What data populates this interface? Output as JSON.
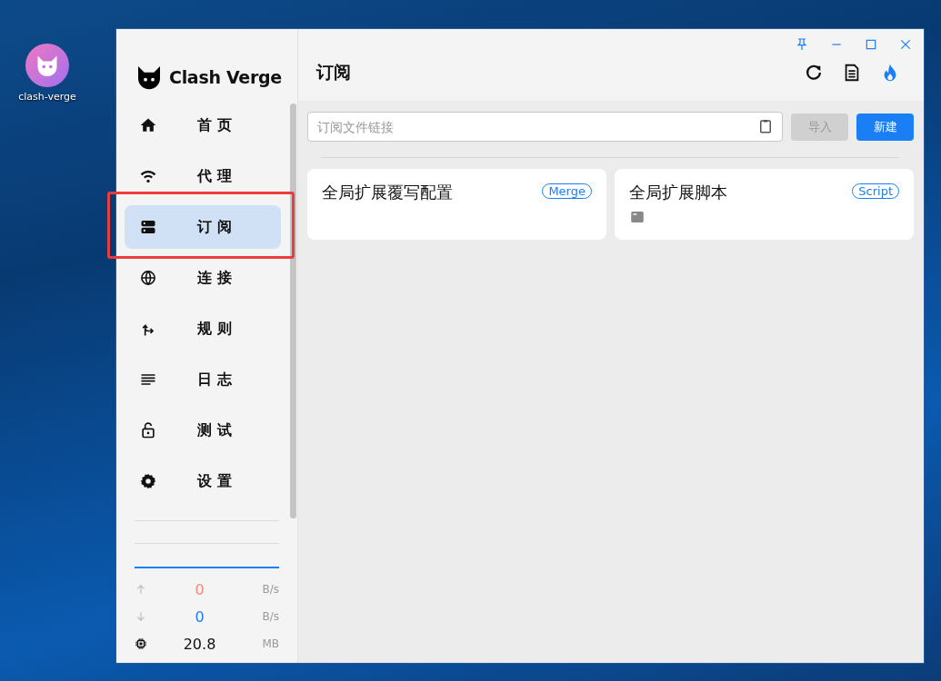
{
  "desktop": {
    "icon_label": "clash-verge"
  },
  "sidebar": {
    "logo_text": "Clash Verge",
    "items": [
      {
        "label": "首 页",
        "selected": false,
        "highlighted": false
      },
      {
        "label": "代 理",
        "selected": false,
        "highlighted": false
      },
      {
        "label": "订 阅",
        "selected": true,
        "highlighted": true
      },
      {
        "label": "连 接",
        "selected": false,
        "highlighted": false
      },
      {
        "label": "规 则",
        "selected": false,
        "highlighted": false
      },
      {
        "label": "日 志",
        "selected": false,
        "highlighted": false
      },
      {
        "label": "测 试",
        "selected": false,
        "highlighted": false
      },
      {
        "label": "设 置",
        "selected": false,
        "highlighted": false
      }
    ],
    "stats": [
      {
        "kind": "up",
        "value": "0",
        "unit": "B/s",
        "color": "#f28b7c"
      },
      {
        "kind": "down",
        "value": "0",
        "unit": "B/s",
        "color": "#1a7ff5"
      },
      {
        "kind": "memory",
        "value": "20.8",
        "unit": "MB",
        "color": "#111111"
      }
    ]
  },
  "header": {
    "title": "订阅"
  },
  "toolbar": {
    "placeholder": "订阅文件链接",
    "import_button": {
      "label": "导入",
      "disabled": true
    },
    "new_button": {
      "label": "新建",
      "disabled": false
    }
  },
  "cards": [
    {
      "kind": "merge",
      "title": "全局扩展覆写配置",
      "tag": "Merge"
    },
    {
      "kind": "script",
      "title": "全局扩展脚本",
      "tag": "Script"
    }
  ]
}
